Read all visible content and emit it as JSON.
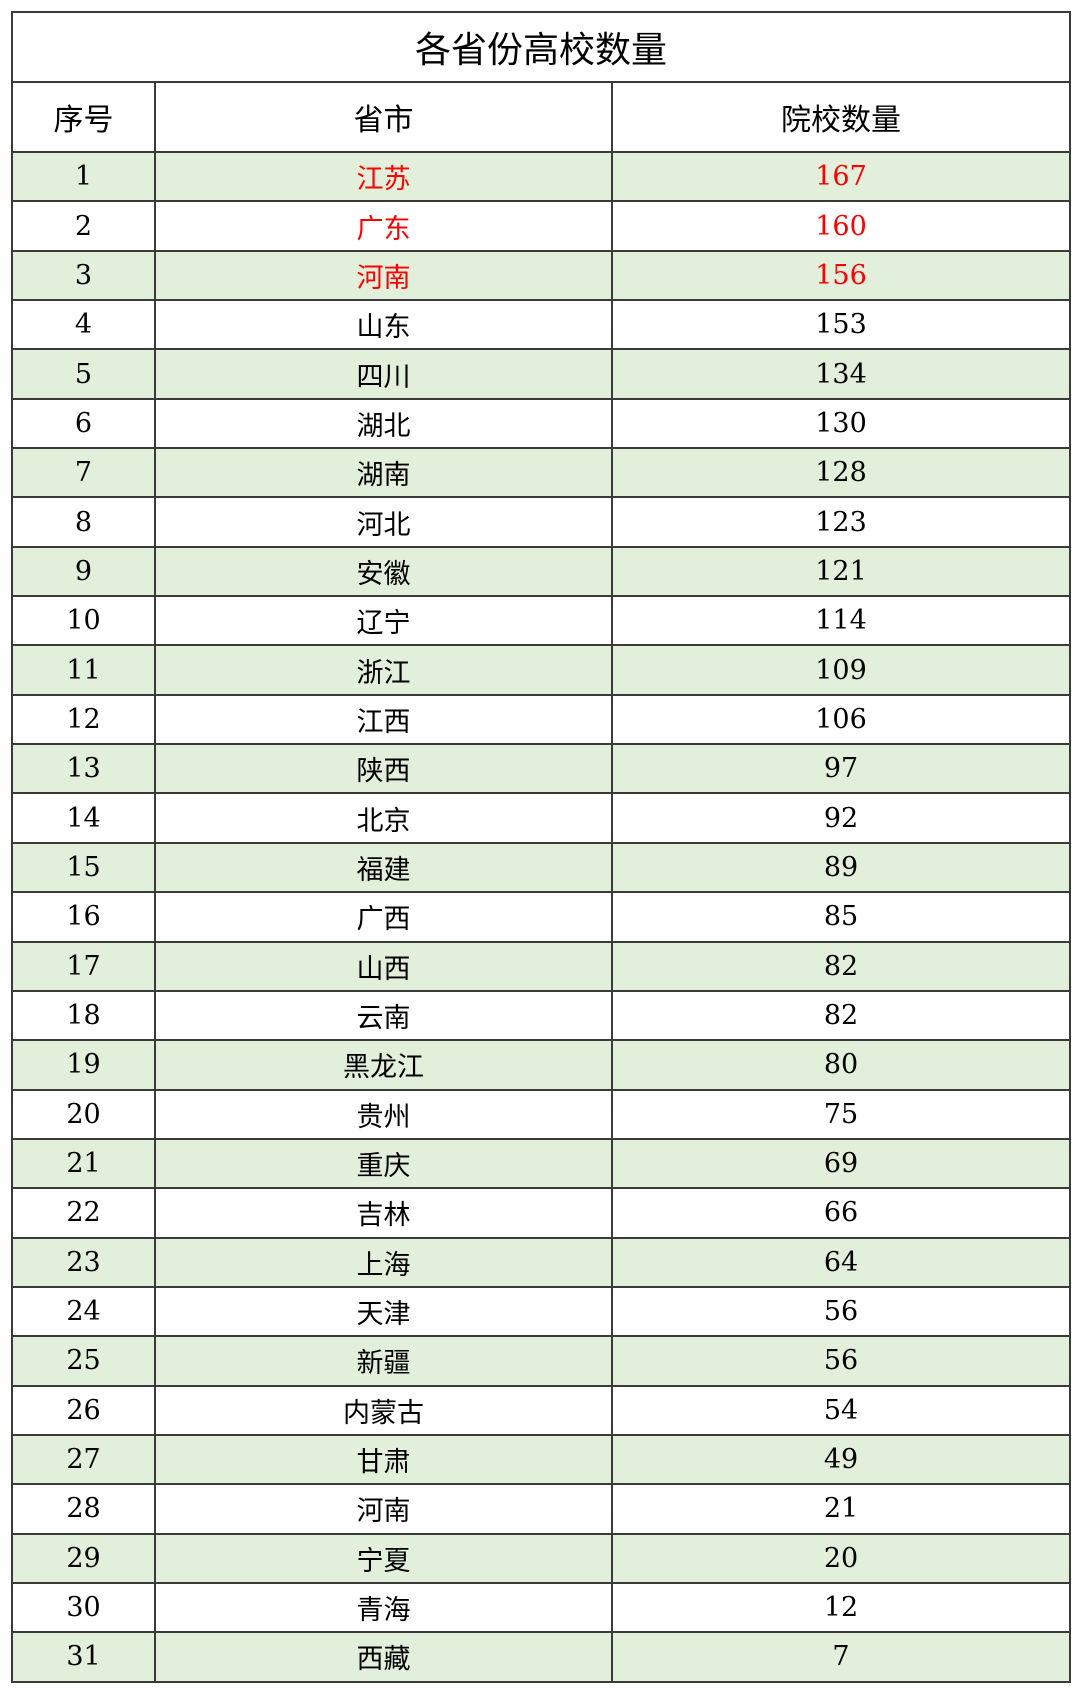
{
  "title": "各省份高校数量",
  "headers": [
    "序号",
    "省市",
    "院校数量"
  ],
  "colors": {
    "highlight_text": "#ff0000",
    "alt_row_bg": "#e2efda",
    "border": "#3a3a3a"
  },
  "highlight_top_n": 3,
  "rows": [
    {
      "rank": "1",
      "province": "江苏",
      "count": "167"
    },
    {
      "rank": "2",
      "province": "广东",
      "count": "160"
    },
    {
      "rank": "3",
      "province": "河南",
      "count": "156"
    },
    {
      "rank": "4",
      "province": "山东",
      "count": "153"
    },
    {
      "rank": "5",
      "province": "四川",
      "count": "134"
    },
    {
      "rank": "6",
      "province": "湖北",
      "count": "130"
    },
    {
      "rank": "7",
      "province": "湖南",
      "count": "128"
    },
    {
      "rank": "8",
      "province": "河北",
      "count": "123"
    },
    {
      "rank": "9",
      "province": "安徽",
      "count": "121"
    },
    {
      "rank": "10",
      "province": "辽宁",
      "count": "114"
    },
    {
      "rank": "11",
      "province": "浙江",
      "count": "109"
    },
    {
      "rank": "12",
      "province": "江西",
      "count": "106"
    },
    {
      "rank": "13",
      "province": "陕西",
      "count": "97"
    },
    {
      "rank": "14",
      "province": "北京",
      "count": "92"
    },
    {
      "rank": "15",
      "province": "福建",
      "count": "89"
    },
    {
      "rank": "16",
      "province": "广西",
      "count": "85"
    },
    {
      "rank": "17",
      "province": "山西",
      "count": "82"
    },
    {
      "rank": "18",
      "province": "云南",
      "count": "82"
    },
    {
      "rank": "19",
      "province": "黑龙江",
      "count": "80"
    },
    {
      "rank": "20",
      "province": "贵州",
      "count": "75"
    },
    {
      "rank": "21",
      "province": "重庆",
      "count": "69"
    },
    {
      "rank": "22",
      "province": "吉林",
      "count": "66"
    },
    {
      "rank": "23",
      "province": "上海",
      "count": "64"
    },
    {
      "rank": "24",
      "province": "天津",
      "count": "56"
    },
    {
      "rank": "25",
      "province": "新疆",
      "count": "56"
    },
    {
      "rank": "26",
      "province": "内蒙古",
      "count": "54"
    },
    {
      "rank": "27",
      "province": "甘肃",
      "count": "49"
    },
    {
      "rank": "28",
      "province": "河南",
      "count": "21"
    },
    {
      "rank": "29",
      "province": "宁夏",
      "count": "20"
    },
    {
      "rank": "30",
      "province": "青海",
      "count": "12"
    },
    {
      "rank": "31",
      "province": "西藏",
      "count": "7"
    }
  ]
}
